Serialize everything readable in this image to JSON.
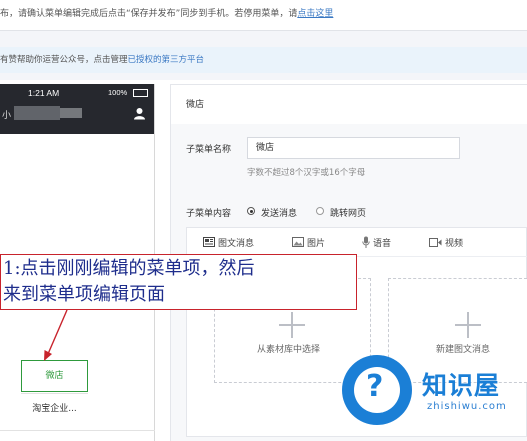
{
  "notice": {
    "text": "布，请确认菜单编辑完成后点击“保存并发布”同步到手机。若停用菜单，请",
    "link": "点击这里"
  },
  "info": {
    "text": "有赞帮助你运营公众号，点击管理",
    "link": "已授权的第三方平台"
  },
  "phone": {
    "time": "1:21 AM",
    "battery": "100%",
    "account_fragment": "小",
    "menu_active": "微店",
    "menu_item_2": "淘宝企业..."
  },
  "editor": {
    "title": "微店",
    "name_label": "子菜单名称",
    "name_value": "微店",
    "name_hint": "字数不超过8个汉字或16个字母",
    "content_label": "子菜单内容",
    "radio_send": "发送消息",
    "radio_jump": "跳转网页",
    "tabs": [
      "图文消息",
      "图片",
      "语音",
      "视频"
    ],
    "slot_library": "从素材库中选择",
    "slot_new": "新建图文消息"
  },
  "annotation": {
    "line1": "1:点击刚刚编辑的菜单项，然后",
    "line2": "来到菜单项编辑页面"
  },
  "watermark": {
    "name": "知识屋",
    "url": "zhishiwu.com"
  },
  "colors": {
    "link": "#3a78c3",
    "active_green": "#2e9a3c",
    "annotation_border": "#c8232c",
    "annotation_text": "#1e2d8c",
    "watermark_blue": "#1b7fd6"
  },
  "icons": [
    "person-icon",
    "news-icon",
    "image-icon",
    "mic-icon",
    "video-icon",
    "plus-icon",
    "arrow-icon"
  ]
}
